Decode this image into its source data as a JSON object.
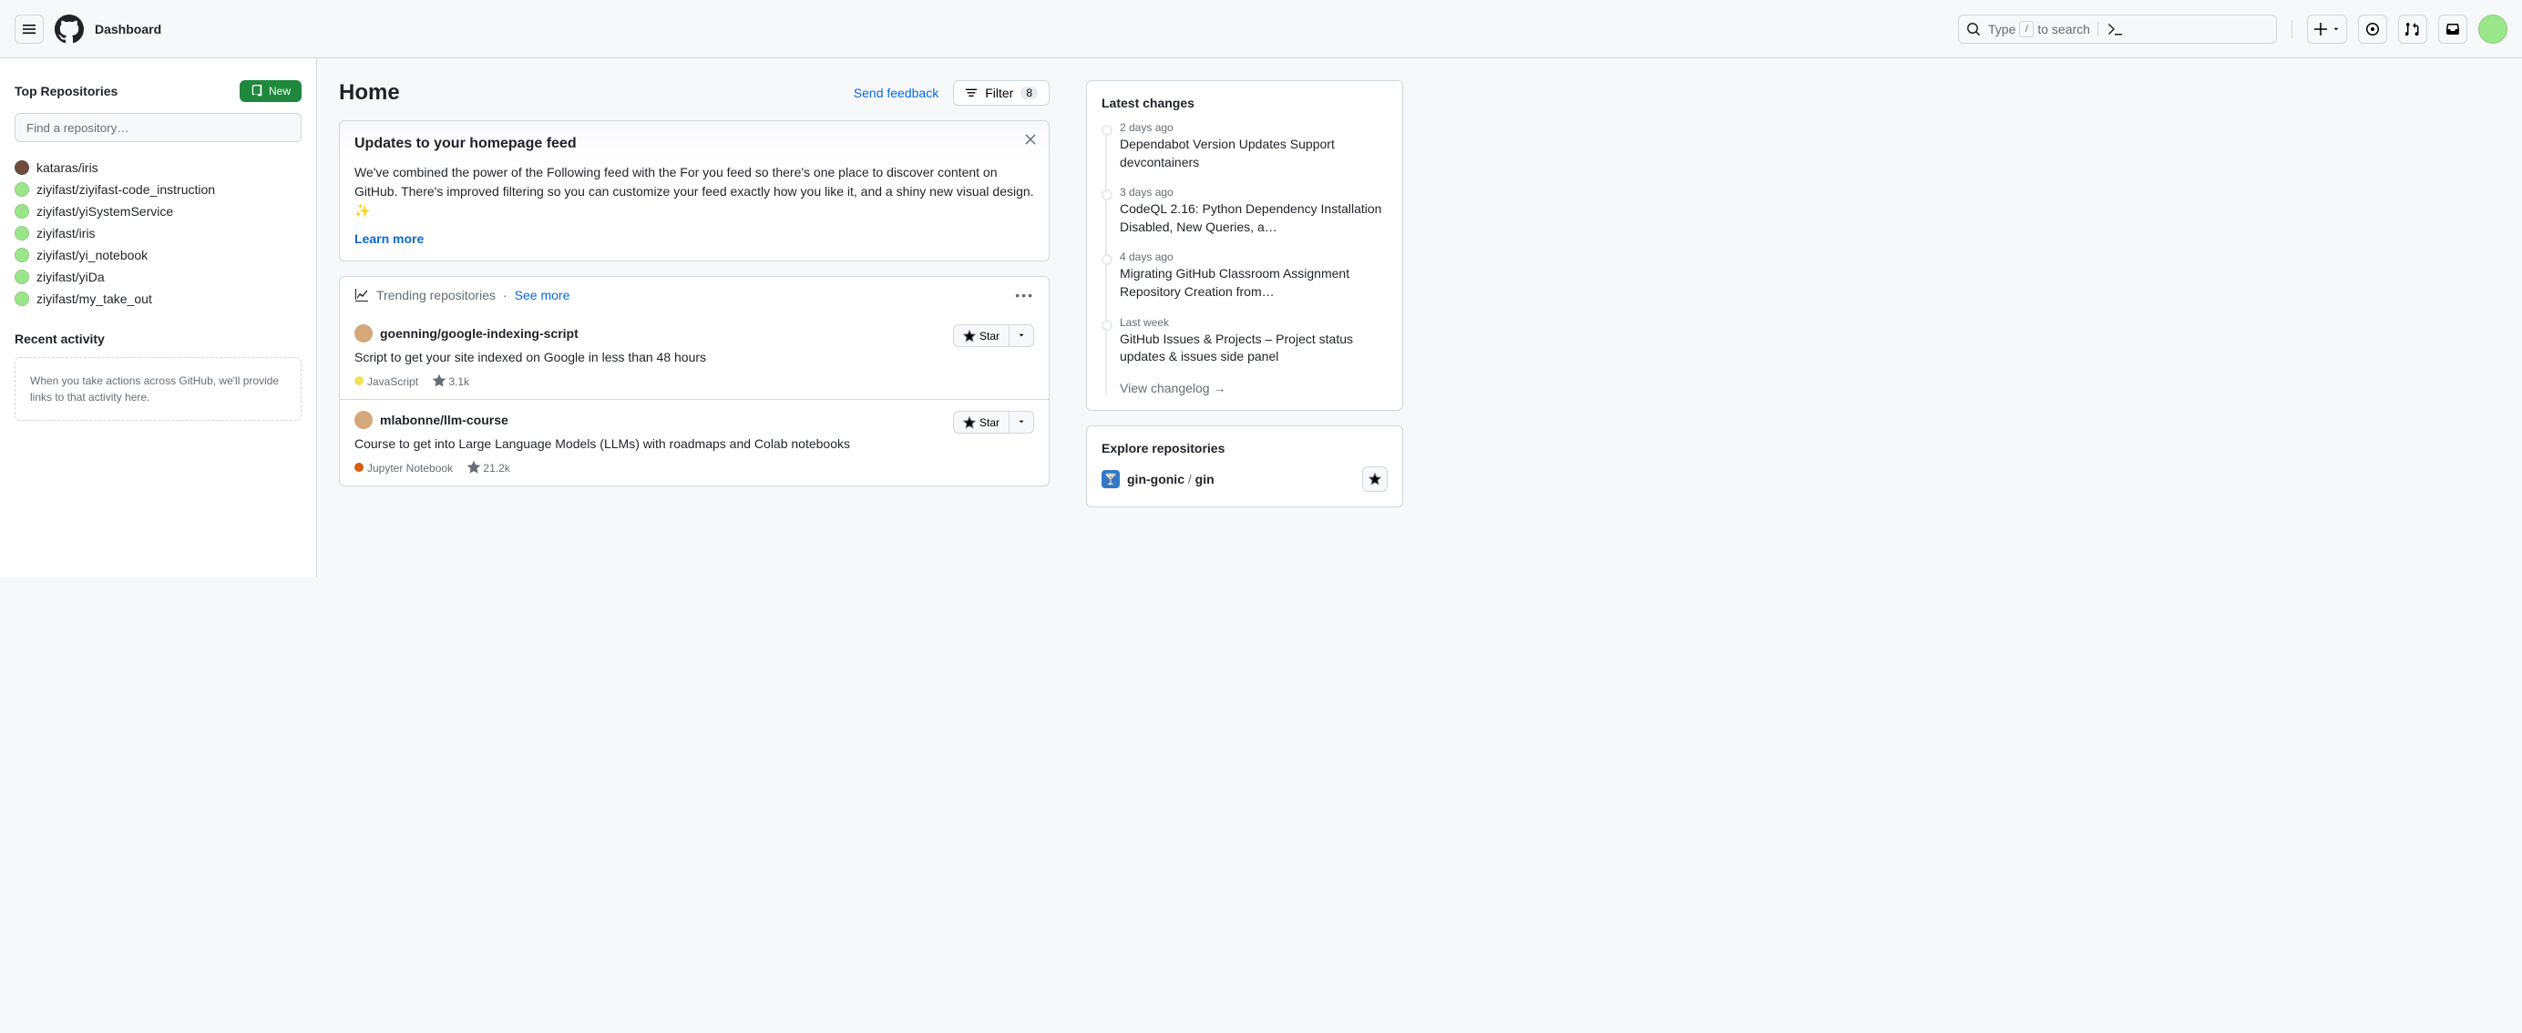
{
  "header": {
    "title": "Dashboard",
    "search_prefix": "Type",
    "search_suffix": "to search",
    "slash": "/"
  },
  "sidebar": {
    "top_repos_title": "Top Repositories",
    "new_btn": "New",
    "repo_search_placeholder": "Find a repository…",
    "repos": [
      {
        "owner": "kataras",
        "name": "iris",
        "avatar": "kataras"
      },
      {
        "owner": "ziyifast",
        "name": "ziyifast-code_instruction",
        "avatar": "me"
      },
      {
        "owner": "ziyifast",
        "name": "yiSystemService",
        "avatar": "me"
      },
      {
        "owner": "ziyifast",
        "name": "iris",
        "avatar": "me"
      },
      {
        "owner": "ziyifast",
        "name": "yi_notebook",
        "avatar": "me"
      },
      {
        "owner": "ziyifast",
        "name": "yiDa",
        "avatar": "me"
      },
      {
        "owner": "ziyifast",
        "name": "my_take_out",
        "avatar": "me"
      }
    ],
    "recent_title": "Recent activity",
    "recent_empty": "When you take actions across GitHub, we'll provide links to that activity here."
  },
  "feed": {
    "title": "Home",
    "feedback": "Send feedback",
    "filter_label": "Filter",
    "filter_count": "8",
    "notice": {
      "title": "Updates to your homepage feed",
      "body": "We've combined the power of the Following feed with the For you feed so there's one place to discover content on GitHub. There's improved filtering so you can customize your feed exactly how you like it, and a shiny new visual design. ✨",
      "learn_more": "Learn more"
    },
    "trending": {
      "label": "Trending repositories",
      "dot": "·",
      "see_more": "See more",
      "items": [
        {
          "title": "goenning/google-indexing-script",
          "desc": "Script to get your site indexed on Google in less than 48 hours",
          "lang": "JavaScript",
          "lang_color": "#f1e05a",
          "stars": "3.1k",
          "star_label": "Star"
        },
        {
          "title": "mlabonne/llm-course",
          "desc": "Course to get into Large Language Models (LLMs) with roadmaps and Colab notebooks",
          "lang": "Jupyter Notebook",
          "lang_color": "#DA5B0B",
          "stars": "21.2k",
          "star_label": "Star"
        }
      ]
    }
  },
  "changes": {
    "title": "Latest changes",
    "items": [
      {
        "time": "2 days ago",
        "title": "Dependabot Version Updates Support devcontainers"
      },
      {
        "time": "3 days ago",
        "title": "CodeQL 2.16: Python Dependency Installation Disabled, New Queries, a…"
      },
      {
        "time": "4 days ago",
        "title": "Migrating GitHub Classroom Assignment Repository Creation from…"
      },
      {
        "time": "Last week",
        "title": "GitHub Issues & Projects – Project status updates & issues side panel"
      }
    ],
    "view_changelog": "View changelog →"
  },
  "explore": {
    "title": "Explore repositories",
    "items": [
      {
        "owner": "gin-gonic",
        "name": "gin",
        "emoji": "🍸"
      }
    ]
  }
}
